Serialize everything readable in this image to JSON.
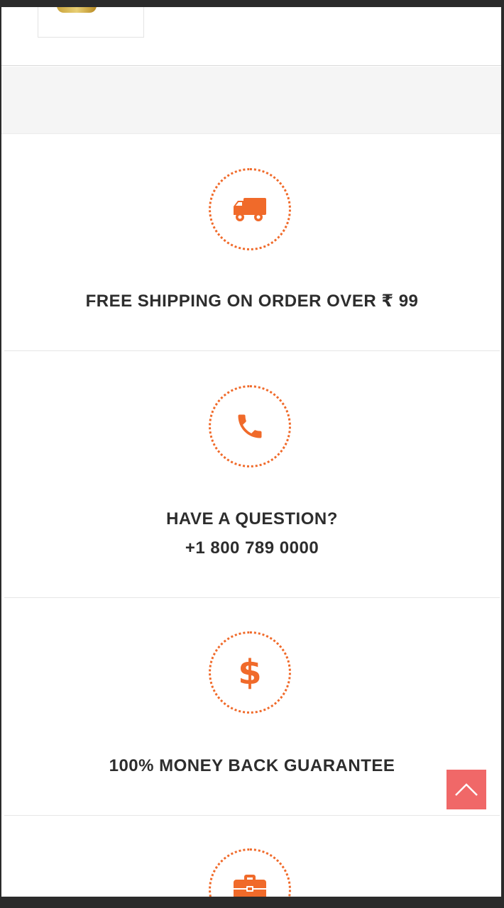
{
  "features": [
    {
      "icon": "truck-icon",
      "title": "FREE SHIPPING ON ORDER OVER ₹ 99"
    },
    {
      "icon": "phone-icon",
      "title_line1": "HAVE A QUESTION?",
      "title_line2": "+1 800 789 0000"
    },
    {
      "icon": "dollar-icon",
      "icon_glyph": "$",
      "title": "100% MONEY BACK GUARANTEE"
    },
    {
      "icon": "briefcase-icon"
    }
  ],
  "colors": {
    "accent": "#f06a2a",
    "back_to_top": "#f06868",
    "text": "#2d2d2d",
    "band": "#f5f5f5"
  },
  "back_to_top": {
    "icon": "chevron-up-icon"
  }
}
